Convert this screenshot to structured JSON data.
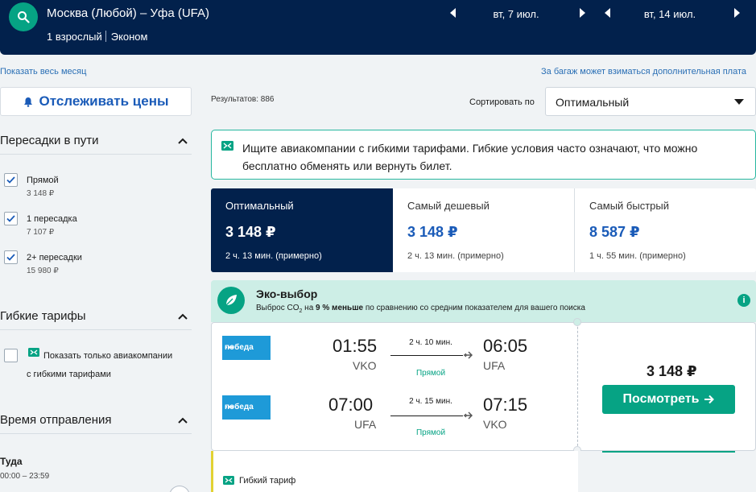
{
  "header": {
    "route": "Москва (Любой) – Уфа (UFA)",
    "passengers": "1 взрослый",
    "class": "Эконом",
    "date_out": "вт, 7 июл.",
    "date_back": "вт, 14 июл."
  },
  "links": {
    "whole_month": "Показать весь месяц",
    "baggage": "За багаж может взиматься дополнительная плата"
  },
  "sidebar": {
    "track_button": "Отслеживать цены",
    "stops_title": "Пересадки в пути",
    "stops": [
      {
        "label": "Прямой",
        "price": "3 148 ₽",
        "checked": true
      },
      {
        "label": "1 пересадка",
        "price": "7 107 ₽",
        "checked": true
      },
      {
        "label": "2+ пересадки",
        "price": "15 980 ₽",
        "checked": true
      }
    ],
    "flex_title": "Гибкие тарифы",
    "flex_option_line1": "Показать только авиакомпании",
    "flex_option_line2": "с гибкими тарифами",
    "departure_title": "Время отправления",
    "departure_there": "Туда",
    "departure_range": "00:00 – 23:59"
  },
  "main": {
    "results": "Результатов: 886",
    "sort_label": "Сортировать по",
    "sort_value": "Оптимальный",
    "flex_notice": "Ищите авиакомпании с гибкими тарифами. Гибкие условия часто означают, что можно бесплатно обменять или вернуть билет.",
    "tabs": [
      {
        "name": "Оптимальный",
        "price": "3 148 ₽",
        "time": "2 ч. 13 мин. (примерно)"
      },
      {
        "name": "Самый дешевый",
        "price": "3 148 ₽",
        "time": "2 ч. 13 мин. (примерно)"
      },
      {
        "name": "Самый быстрый",
        "price": "8 587 ₽",
        "time": "1 ч. 55 мин. (примерно)"
      }
    ],
    "eco_title": "Эко-выбор",
    "eco_sub_a": "Выброс CO",
    "eco_sub_sub": "2",
    "eco_sub_b": " на ",
    "eco_sub_bold": "9 % меньше",
    "eco_sub_c": " по сравнению со средним показателем для вашего поиска",
    "eco_info": "i",
    "ticket": {
      "airline": "победа",
      "outbound": {
        "dep": "01:55",
        "dep_code": "VKO",
        "duration": "2 ч. 10 мин.",
        "stops": "Прямой",
        "arr": "06:05",
        "arr_code": "UFA"
      },
      "inbound": {
        "dep": "07:00",
        "dep_code": "UFA",
        "duration": "2 ч. 15 мин.",
        "stops": "Прямой",
        "arr": "07:15",
        "arr_code": "VKO"
      },
      "price": "3 148 ₽",
      "view_button": "Посмотреть"
    },
    "next_flex_label": "Гибкий тариф"
  },
  "colors": {
    "header_bg": "#02214c",
    "accent_green": "#06a384",
    "link_blue": "#1a5bb8",
    "eco_bg": "#cdeee6"
  }
}
